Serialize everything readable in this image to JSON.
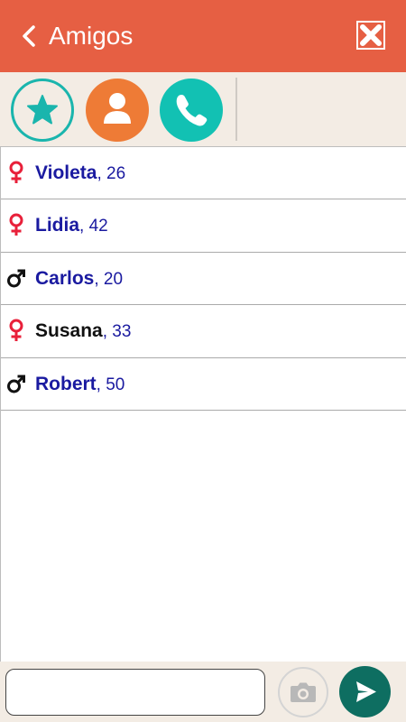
{
  "header": {
    "title": "Amigos",
    "back_icon": "chevron-left-icon",
    "close_icon": "close-box-icon"
  },
  "toolbar": {
    "buttons": [
      {
        "icon": "star-icon",
        "color": "#1ab5ad"
      },
      {
        "icon": "person-icon",
        "color": "#ee7b36"
      },
      {
        "icon": "phone-icon",
        "color": "#12c1b3"
      }
    ]
  },
  "friends": [
    {
      "name": "Violeta",
      "age": ", 26",
      "gender": "female",
      "name_color": "#1a1aa0"
    },
    {
      "name": "Lidia",
      "age": ", 42",
      "gender": "female",
      "name_color": "#1a1aa0"
    },
    {
      "name": "Carlos",
      "age": ", 20",
      "gender": "male",
      "name_color": "#1a1aa0"
    },
    {
      "name": "Susana",
      "age": ", 33",
      "gender": "female",
      "name_color": "#111111"
    },
    {
      "name": "Robert",
      "age": ", 50",
      "gender": "male",
      "name_color": "#1a1aa0"
    }
  ],
  "composer": {
    "placeholder": "",
    "camera_icon": "camera-icon",
    "send_icon": "send-icon"
  },
  "colors": {
    "header": "#e65f43",
    "female_symbol": "#e8203a",
    "male_symbol": "#111111",
    "send": "#0e6e61"
  }
}
